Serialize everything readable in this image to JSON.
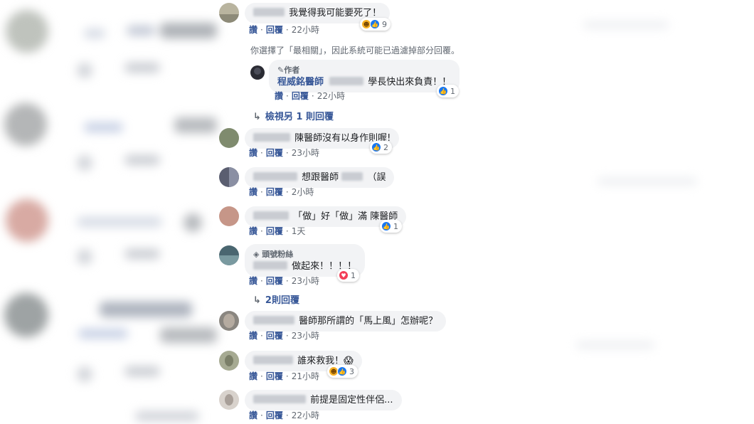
{
  "comments": [
    {
      "text": "我覺得我可能要死了！",
      "like": "讚",
      "reply": "回覆",
      "time": "22小時",
      "reactions": [
        "haha",
        "like"
      ],
      "count": "9"
    },
    {
      "author_badge": "作者",
      "name": "程威銘醫師",
      "text": "學長快出來負責！！",
      "like": "讚",
      "reply": "回覆",
      "time": "22小時",
      "reactions": [
        "like"
      ],
      "count": "1"
    },
    {
      "text": "陳醫師沒有以身作則喔!",
      "like": "讚",
      "reply": "回覆",
      "time": "23小時",
      "reactions": [
        "like"
      ],
      "count": "2"
    },
    {
      "text": "想跟醫師",
      "text_tail": "（誤",
      "like": "讚",
      "reply": "回覆",
      "time": "2小時"
    },
    {
      "text": "「做」好「做」滿 陳醫師",
      "like": "讚",
      "reply": "回覆",
      "time": "1天",
      "reactions": [
        "like"
      ],
      "count": "1"
    },
    {
      "badge": "頭號粉絲",
      "text": "做起來！！！！",
      "like": "讚",
      "reply": "回覆",
      "time": "23小時",
      "reactions": [
        "love"
      ],
      "count": "1"
    },
    {
      "text": "醫師那所謂的「馬上風」怎辦呢？",
      "like": "讚",
      "reply": "回覆",
      "time": "23小時"
    },
    {
      "text": "誰來救我！😱",
      "like": "讚",
      "reply": "回覆",
      "time": "21小時",
      "reactions": [
        "haha",
        "like"
      ],
      "count": "3"
    },
    {
      "text": "前提是固定性伴侶...",
      "like": "讚",
      "reply": "回覆",
      "time": "22小時"
    }
  ],
  "filter_notice": "你選擇了「最相關」，因此系統可能已過濾掉部分回覆。",
  "view_more_1": "檢視另 1 則回覆",
  "view_more_2": "2則回覆",
  "colors": {
    "link": "#385898",
    "bubble": "#f2f3f5",
    "like": "#1877f2",
    "love": "#f33e58",
    "haha": "#f7b125"
  }
}
